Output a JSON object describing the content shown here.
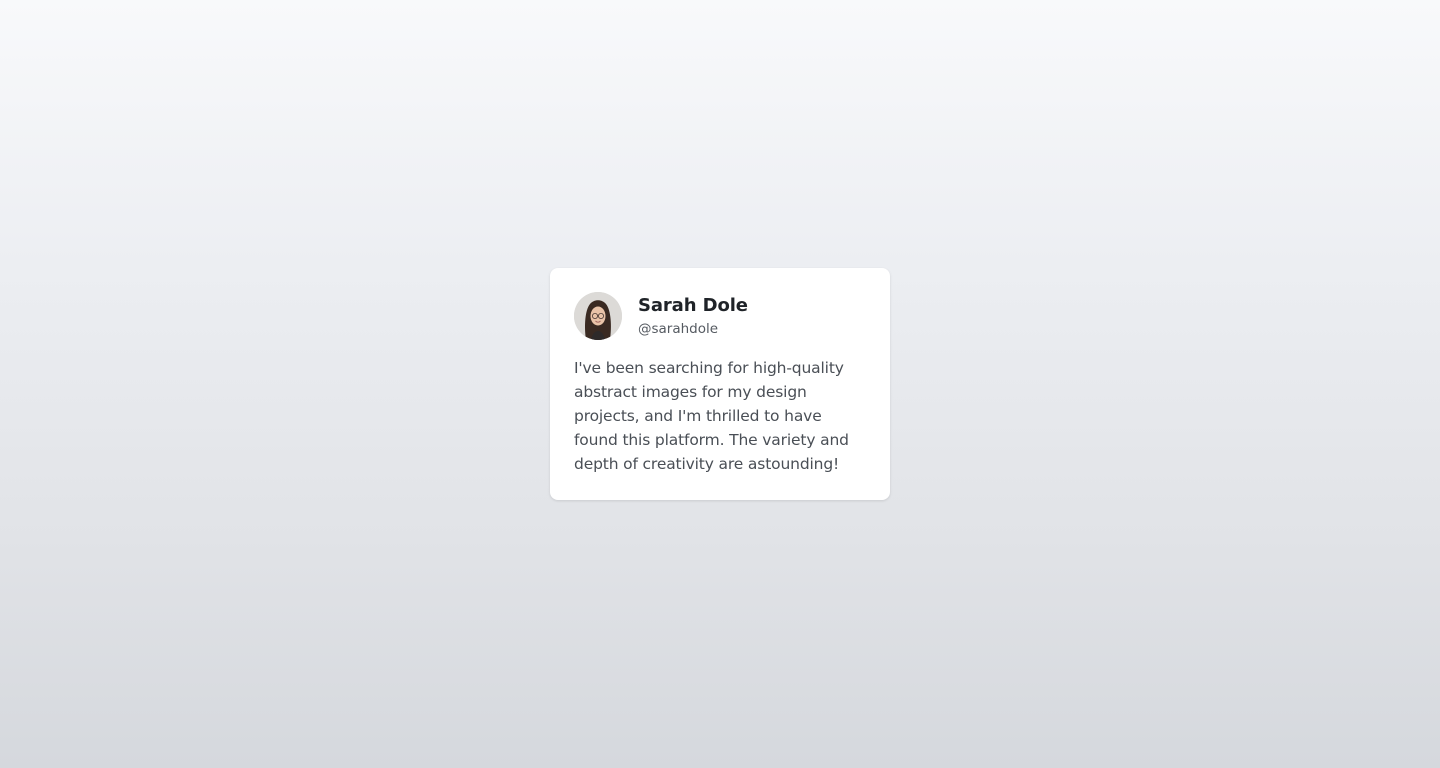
{
  "testimonial": {
    "author_name": "Sarah Dole",
    "author_handle": "@sarahdole",
    "quote": "I've been searching for high-quality abstract images for my design projects, and I'm thrilled to have found this platform. The variety and depth of creativity are astounding!"
  },
  "colors": {
    "card_background": "#ffffff",
    "name_text": "#1f2328",
    "handle_text": "#555a61",
    "body_text": "#4a4f56"
  }
}
